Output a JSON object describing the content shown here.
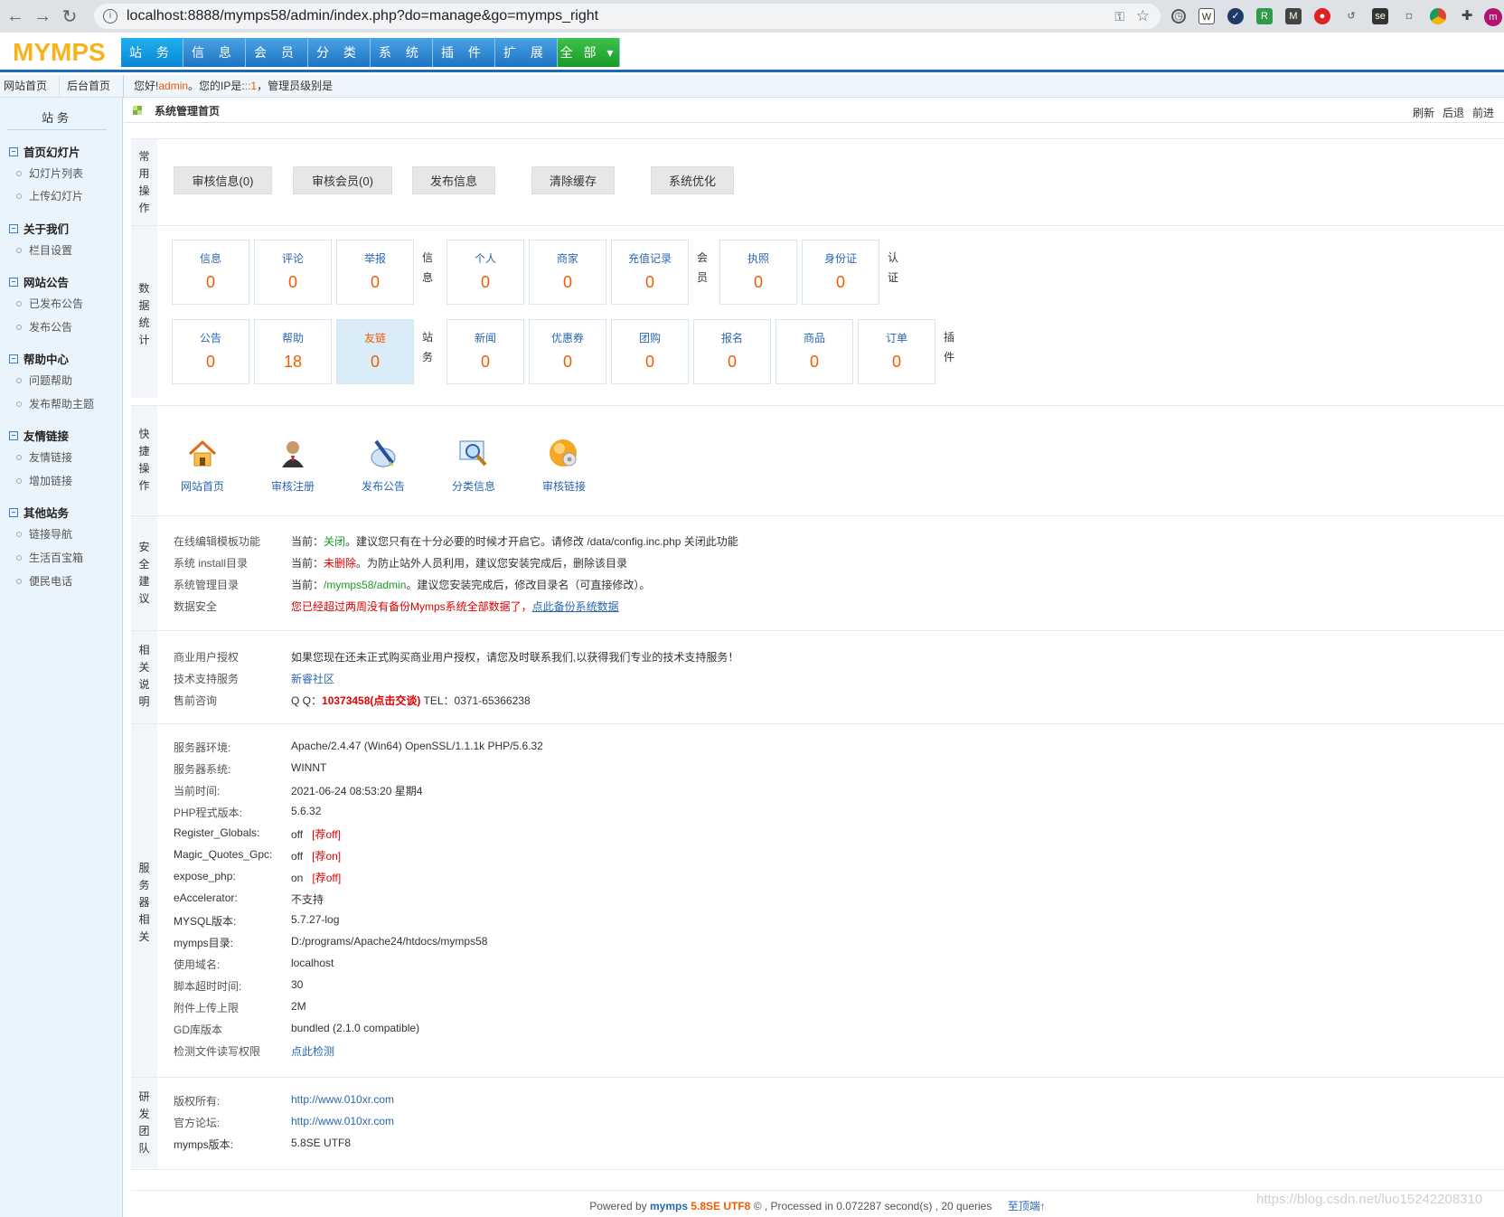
{
  "browser": {
    "url": "localhost:8888/mymps58/admin/index.php?do=manage&go=mymps_right",
    "back": "←",
    "forward": "→",
    "reload": "↻"
  },
  "app": {
    "logo": "MYMPS",
    "nav": [
      "站 务",
      "信 息",
      "会 员",
      "分 类",
      "系 统",
      "插 件",
      "扩 展"
    ],
    "nav_all": "全 部 ▾"
  },
  "subbar": {
    "home1": "网站首页",
    "home2": "后台首页",
    "greet_pre": "您好!",
    "user": "admin",
    "greet_mid": "。您的IP是:",
    "ip": "::1",
    "greet_post": "，管理员级别是"
  },
  "sidebar": {
    "title": "站务",
    "groups": [
      {
        "name": "首页幻灯片",
        "items": [
          "幻灯片列表",
          "上传幻灯片"
        ]
      },
      {
        "name": "关于我们",
        "items": [
          "栏目设置"
        ]
      },
      {
        "name": "网站公告",
        "items": [
          "已发布公告",
          "发布公告"
        ]
      },
      {
        "name": "帮助中心",
        "items": [
          "问题帮助",
          "发布帮助主题"
        ]
      },
      {
        "name": "友情链接",
        "items": [
          "友情链接",
          "增加链接"
        ]
      },
      {
        "name": "其他站务",
        "items": [
          "链接导航",
          "生活百宝箱",
          "便民电话"
        ]
      }
    ]
  },
  "page": {
    "title": "系统管理首页",
    "refresh": "刷新",
    "back": "后退",
    "forward": "前进"
  },
  "labels": {
    "ops": "常用操作",
    "stats": "数据统计",
    "quick": "快捷操作",
    "security": "安全建议",
    "about": "相关说明",
    "server": "服务器相关",
    "team": "研发团队"
  },
  "ops": [
    "审核信息(0)",
    "审核会员(0)",
    "发布信息",
    "清除缓存",
    "系统优化"
  ],
  "stats": {
    "info": [
      {
        "label": "信息",
        "value": "0"
      },
      {
        "label": "评论",
        "value": "0"
      },
      {
        "label": "举报",
        "value": "0"
      }
    ],
    "info_tag": "信息",
    "member": [
      {
        "label": "个人",
        "value": "0"
      },
      {
        "label": "商家",
        "value": "0"
      },
      {
        "label": "充值记录",
        "value": "0"
      }
    ],
    "member_tag": "会员",
    "cert": [
      {
        "label": "执照",
        "value": "0"
      },
      {
        "label": "身份证",
        "value": "0"
      }
    ],
    "cert_tag": "认证",
    "site": [
      {
        "label": "公告",
        "value": "0"
      },
      {
        "label": "帮助",
        "value": "18"
      },
      {
        "label": "友链",
        "value": "0"
      }
    ],
    "site_tag": "站务",
    "plugin": [
      {
        "label": "新闻",
        "value": "0"
      },
      {
        "label": "优惠券",
        "value": "0"
      },
      {
        "label": "团购",
        "value": "0"
      },
      {
        "label": "报名",
        "value": "0"
      },
      {
        "label": "商品",
        "value": "0"
      },
      {
        "label": "订单",
        "value": "0"
      }
    ],
    "plugin_tag": "插件"
  },
  "quick": [
    {
      "label": "网站首页",
      "icon": "house-icon"
    },
    {
      "label": "审核注册",
      "icon": "person-icon"
    },
    {
      "label": "发布公告",
      "icon": "pen-icon"
    },
    {
      "label": "分类信息",
      "icon": "magnifier-icon"
    },
    {
      "label": "审核链接",
      "icon": "gear-globe-icon"
    }
  ],
  "security": {
    "k1": "在线编辑模板功能",
    "v1a": "当前：",
    "v1b": "关闭",
    "v1c": "。建议您只有在十分必要的时候才开启它。请修改 /data/config.inc.php 关闭此功能",
    "k2": "系统 install目录",
    "v2a": "当前：",
    "v2b": "未删除",
    "v2c": "。为防止站外人员利用，建议您安装完成后，删除该目录",
    "k3": "系统管理目录",
    "v3a": "当前：",
    "v3b": "/mymps58/admin",
    "v3c": "。建议您安装完成后，修改目录名（可直接修改）。",
    "k4": "数据安全",
    "v4a": "您已经超过两周没有备份Mymps系统全部数据了，",
    "v4b": "点此备份系统数据"
  },
  "about": {
    "k1": "商业用户授权",
    "v1": "如果您现在还未正式购买商业用户授权，请您及时联系我们,以获得我们专业的技术支持服务！",
    "k2": "技术支持服务",
    "v2": "新睿社区",
    "k3": "售前咨询",
    "v3a": "Q Q：",
    "v3b": "10373458(点击交谈)",
    "v3c": "TEL：0371-65366238"
  },
  "server": [
    {
      "k": "服务器环境:",
      "v": "Apache/2.4.47 (Win64) OpenSSL/1.1.1k PHP/5.6.32"
    },
    {
      "k": "服务器系统:",
      "v": "WINNT"
    },
    {
      "k": "当前时间:",
      "v": "2021-06-24 08:53:20 星期4"
    },
    {
      "k": "PHP程式版本:",
      "v": "5.6.32"
    },
    {
      "k": "Register_Globals:",
      "v": "off",
      "r": "[荐off]"
    },
    {
      "k": "Magic_Quotes_Gpc:",
      "v": "off",
      "r": "[荐on]"
    },
    {
      "k": "expose_php:",
      "v": "on",
      "r": "[荐off]"
    },
    {
      "k": "eAccelerator:",
      "v": "不支持"
    },
    {
      "k": "MYSQL版本:",
      "v": "5.7.27-log"
    },
    {
      "k": "mymps目录:",
      "v": "D:/programs/Apache24/htdocs/mymps58"
    },
    {
      "k": "使用域名:",
      "v": "localhost"
    },
    {
      "k": "脚本超时时间:",
      "v": "30"
    },
    {
      "k": "附件上传上限",
      "v": "2M"
    },
    {
      "k": "GD库版本",
      "v": "bundled (2.1.0 compatible)"
    },
    {
      "k": "检测文件读写权限",
      "v": "点此检测"
    }
  ],
  "team": [
    {
      "k": "版权所有:",
      "v": "http://www.010xr.com"
    },
    {
      "k": "官方论坛:",
      "v": "http://www.010xr.com"
    },
    {
      "k": "mymps版本:",
      "v": "5.8SE UTF8"
    }
  ],
  "footer": {
    "a": "Powered by ",
    "b": "mymps",
    "c": " 5.8SE UTF8",
    "d": " © , Processed in 0.072287 second(s) , 20 queries",
    "e": "至顶端↑",
    "wm": "https://blog.csdn.net/luo15242208310"
  },
  "colors": {
    "accent": "#1a6bb5",
    "orange": "#f55a00",
    "red": "#e00000",
    "green": "#1a9a26"
  }
}
